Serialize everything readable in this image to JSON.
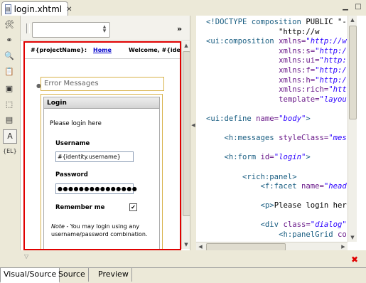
{
  "editor_tab": {
    "title": "login.xhtml",
    "file_icon": "xhtml-file-icon",
    "close_glyph": "✕"
  },
  "palette": {
    "items": [
      {
        "name": "tools-icon",
        "glyph": "🛠"
      },
      {
        "name": "link-icon",
        "glyph": "⚭"
      },
      {
        "name": "find-icon",
        "glyph": "🔍"
      },
      {
        "name": "clipboard-icon",
        "glyph": "📋"
      },
      {
        "name": "bundle-icon",
        "glyph": "▣"
      },
      {
        "name": "frame-icon",
        "glyph": "⬚"
      },
      {
        "name": "panel-icon",
        "glyph": "▤"
      },
      {
        "name": "font-icon",
        "glyph": "A"
      },
      {
        "name": "el-icon",
        "glyph": "{EL}"
      }
    ]
  },
  "visual": {
    "chevron": "»",
    "header": {
      "project": "#{projectName}:",
      "home": "Home",
      "welcome": "Welcome, #{iden"
    },
    "error_messages": "Error Messages",
    "panel": {
      "title": "Login",
      "intro": "Please login here",
      "username_label": "Username",
      "username_value": "#{identity.username}",
      "password_label": "Password",
      "password_value": "●●●●●●●●●●●●●●●",
      "remember_label": "Remember me",
      "remember_checked": "✔",
      "note_label": "Note",
      "note_text": " - You may login using any username/password combination."
    }
  },
  "source": {
    "lines": [
      [
        [
          "kw",
          "<!DOCTYPE composition "
        ],
        [
          "txt",
          "PUBLIC \"-"
        ]
      ],
      [
        [
          "txt",
          "                \"http://w"
        ]
      ],
      [
        [
          "tag",
          "<ui:composition "
        ],
        [
          "attr",
          "xmlns="
        ],
        [
          "val",
          "\"http://w"
        ]
      ],
      [
        [
          "txt",
          "                "
        ],
        [
          "attr",
          "xmlns:s="
        ],
        [
          "val",
          "\"http:/"
        ]
      ],
      [
        [
          "txt",
          "                "
        ],
        [
          "attr",
          "xmlns:ui="
        ],
        [
          "val",
          "\"http:"
        ]
      ],
      [
        [
          "txt",
          "                "
        ],
        [
          "attr",
          "xmlns:f="
        ],
        [
          "val",
          "\"http:/"
        ]
      ],
      [
        [
          "txt",
          "                "
        ],
        [
          "attr",
          "xmlns:h="
        ],
        [
          "val",
          "\"http:/"
        ]
      ],
      [
        [
          "txt",
          "                "
        ],
        [
          "attr",
          "xmlns:rich="
        ],
        [
          "val",
          "\"htt"
        ]
      ],
      [
        [
          "txt",
          "                "
        ],
        [
          "attr",
          "template="
        ],
        [
          "val",
          "\"layou"
        ]
      ],
      [
        [
          "txt",
          ""
        ]
      ],
      [
        [
          "tag",
          "<ui:define "
        ],
        [
          "attr",
          "name="
        ],
        [
          "val",
          "\"body\""
        ],
        [
          "tag",
          ">"
        ]
      ],
      [
        [
          "txt",
          ""
        ]
      ],
      [
        [
          "txt",
          "    "
        ],
        [
          "tag",
          "<h:messages "
        ],
        [
          "attr",
          "styleClass="
        ],
        [
          "val",
          "\"mes"
        ]
      ],
      [
        [
          "txt",
          ""
        ]
      ],
      [
        [
          "txt",
          "    "
        ],
        [
          "tag",
          "<h:form "
        ],
        [
          "attr",
          "id="
        ],
        [
          "val",
          "\"login\""
        ],
        [
          "tag",
          ">"
        ]
      ],
      [
        [
          "txt",
          ""
        ]
      ],
      [
        [
          "txt",
          "        "
        ],
        [
          "tag",
          "<rich:panel>"
        ]
      ],
      [
        [
          "txt",
          "            "
        ],
        [
          "tag",
          "<f:facet "
        ],
        [
          "attr",
          "name="
        ],
        [
          "val",
          "\"head"
        ]
      ],
      [
        [
          "txt",
          ""
        ]
      ],
      [
        [
          "txt",
          "            "
        ],
        [
          "tag",
          "<p>"
        ],
        [
          "txt",
          "Please login her"
        ]
      ],
      [
        [
          "txt",
          ""
        ]
      ],
      [
        [
          "txt",
          "            "
        ],
        [
          "tag",
          "<div "
        ],
        [
          "attr",
          "class="
        ],
        [
          "val",
          "\"dialog\""
        ]
      ],
      [
        [
          "txt",
          "                "
        ],
        [
          "tag",
          "<h:panelGrid "
        ],
        [
          "attr",
          "co"
        ]
      ]
    ]
  },
  "bottom": {
    "min_arrow": "▽",
    "close_glyph": "✖"
  },
  "mode_tabs": [
    {
      "label": "Visual/Source",
      "active": true
    },
    {
      "label": "Source",
      "active": false
    },
    {
      "label": "Preview",
      "active": false
    }
  ]
}
